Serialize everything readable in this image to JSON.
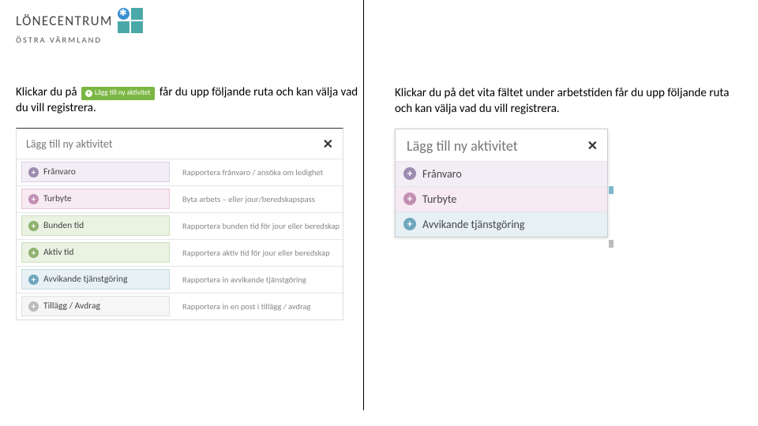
{
  "logo": {
    "main": "LÖNECENTRUM",
    "sub": "ÖSTRA VÄRMLAND"
  },
  "left": {
    "instr_pre": "Klickar du på",
    "inline_btn": "Lägg till ny aktivitet",
    "instr_post": "får du upp följande ruta och kan välja vad du vill registrera.",
    "dialog": {
      "title": "Lägg till ny aktivitet",
      "close": "✕",
      "rows": [
        {
          "label": "Frånvaro",
          "desc": "Rapportera frånvaro / ansöka om ledighet"
        },
        {
          "label": "Turbyte",
          "desc": "Byta arbets – eller jour/beredskapspass"
        },
        {
          "label": "Bunden tid",
          "desc": "Rapportera bunden tid för jour eller beredskap"
        },
        {
          "label": "Aktiv tid",
          "desc": "Rapportera aktiv tid för jour eller beredskap"
        },
        {
          "label": "Avvikande tjänstgöring",
          "desc": "Rapportera in avvikande tjänstgöring"
        },
        {
          "label": "Tillägg / Avdrag",
          "desc": "Rapportera in en post i tillägg / avdrag"
        }
      ]
    }
  },
  "right": {
    "instr": "Klickar du på det vita fältet under arbetstiden får du upp följande ruta och kan välja vad du vill registrera.",
    "dialog": {
      "title": "Lägg till ny aktivitet",
      "close": "✕",
      "rows": [
        {
          "label": "Frånvaro"
        },
        {
          "label": "Turbyte"
        },
        {
          "label": "Avvikande tjänstgöring"
        }
      ]
    }
  }
}
